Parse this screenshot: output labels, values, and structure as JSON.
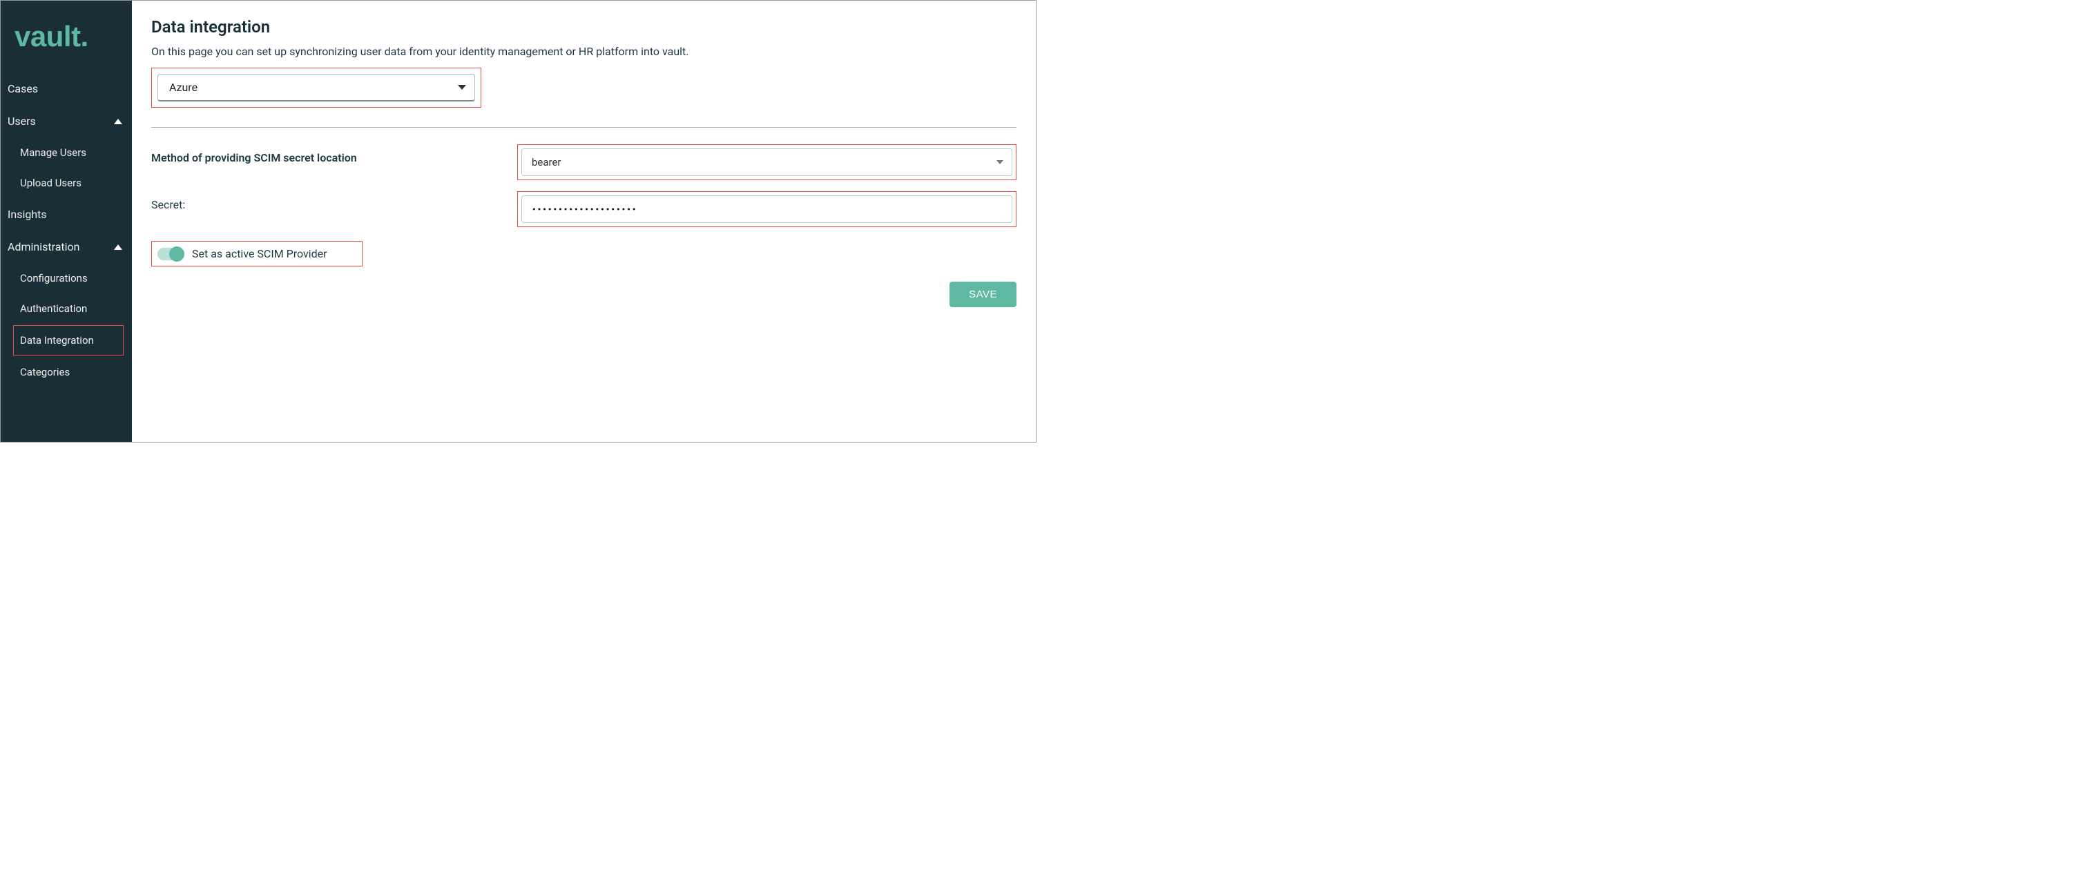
{
  "brand": "vault.",
  "sidebar": {
    "items": [
      {
        "label": "Cases",
        "expandable": false
      },
      {
        "label": "Users",
        "expandable": true,
        "expanded": true
      },
      {
        "label": "Manage Users",
        "sub": true
      },
      {
        "label": "Upload Users",
        "sub": true
      },
      {
        "label": "Insights",
        "expandable": false
      },
      {
        "label": "Administration",
        "expandable": true,
        "expanded": true
      },
      {
        "label": "Configurations",
        "sub": true
      },
      {
        "label": "Authentication",
        "sub": true
      },
      {
        "label": "Data Integration",
        "sub": true,
        "active": true
      },
      {
        "label": "Categories",
        "sub": true
      }
    ]
  },
  "page": {
    "title": "Data integration",
    "subtitle": "On this page you can set up synchronizing user data from your identity management or HR platform into vault.",
    "provider_select": "Azure",
    "method_label": "Method of providing SCIM secret location",
    "method_value": "bearer",
    "secret_label": "Secret:",
    "secret_value": "••••••••••••••••••••",
    "toggle_label": "Set as active SCIM Provider",
    "save_label": "SAVE"
  }
}
